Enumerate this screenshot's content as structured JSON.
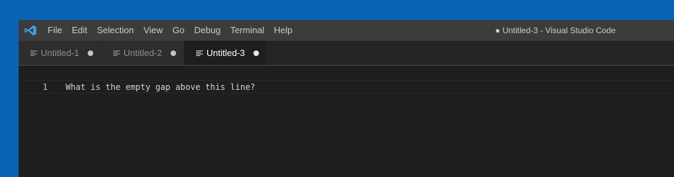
{
  "window": {
    "title": "● Untitled-3 - Visual Studio Code",
    "logo_icon": "vscode-logo-icon"
  },
  "menu": {
    "items": [
      "File",
      "Edit",
      "Selection",
      "View",
      "Go",
      "Debug",
      "Terminal",
      "Help"
    ]
  },
  "tabs": [
    {
      "label": "Untitled-1",
      "active": false,
      "dirty": true,
      "icon": "text-file-icon"
    },
    {
      "label": "Untitled-2",
      "active": false,
      "dirty": true,
      "icon": "text-file-icon"
    },
    {
      "label": "Untitled-3",
      "active": true,
      "dirty": true,
      "icon": "text-file-icon"
    }
  ],
  "editor": {
    "lines": [
      {
        "number": "1",
        "text": "What is the empty gap above this line?"
      }
    ]
  },
  "colors": {
    "desktop": "#0b63b6",
    "titlebar": "#3c3c3c",
    "editor_background": "#1e1e1e",
    "vscode_blue": "#3ea1f0"
  }
}
